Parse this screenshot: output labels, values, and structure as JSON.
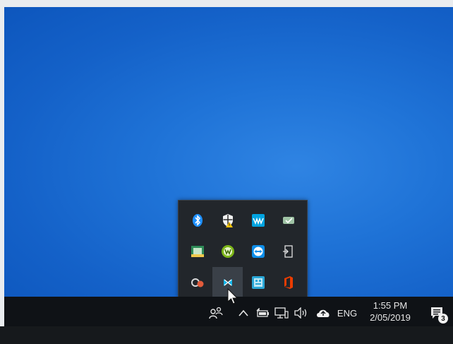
{
  "taskbar": {
    "people_icon": "people-icon",
    "show_hidden_icon": "chevron-up-icon",
    "language": "ENG",
    "clock": {
      "time": "1:55 PM",
      "date": "2/05/2019"
    },
    "notifications": {
      "icon": "action-center-icon",
      "count": "3"
    },
    "system_icons": [
      "battery-icon",
      "network-icon",
      "volume-icon",
      "onedrive-icon"
    ]
  },
  "overflow_tray": {
    "icons": [
      {
        "name": "bluetooth-icon",
        "color": "#1e90ff"
      },
      {
        "name": "windows-defender-icon",
        "color": "#f2f2f2"
      },
      {
        "name": "waves-maxxaudio-icon",
        "color": "#00a3e0"
      },
      {
        "name": "device-connect-icon",
        "color": "#9fc3a5"
      },
      {
        "name": "tray-app-icon",
        "color": "#2e8b57"
      },
      {
        "name": "webroot-icon",
        "color": "#7cb518"
      },
      {
        "name": "teamviewer-icon",
        "color": "#0e8ee9"
      },
      {
        "name": "eject-icon",
        "color": "#e0e0e0"
      },
      {
        "name": "creative-cloud-icon",
        "color": "#e25b3b"
      },
      {
        "name": "xero-icon",
        "color": "#13b5ea"
      },
      {
        "name": "tray-app-icon-2",
        "color": "#2aa7d7"
      },
      {
        "name": "office-icon",
        "color": "#eb3c00"
      }
    ],
    "selected_index": 9
  }
}
